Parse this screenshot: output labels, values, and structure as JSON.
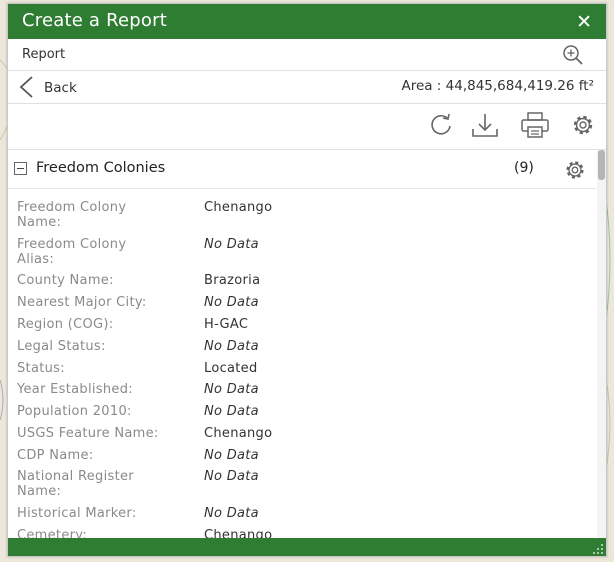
{
  "panel": {
    "title": "Create a Report",
    "close_label": "✕",
    "report_label": "Report",
    "back_label": "Back",
    "area_text": "Area : 44,845,684,419.26 ft²"
  },
  "section": {
    "title": "Freedom Colonies",
    "count": "(9)"
  },
  "fields": [
    {
      "name": "Freedom Colony\nName:",
      "value": "Chenango",
      "no_data": false
    },
    {
      "name": "Freedom Colony\nAlias:",
      "value": "No Data",
      "no_data": true
    },
    {
      "name": "County Name:",
      "value": "Brazoria",
      "no_data": false
    },
    {
      "name": "Nearest Major City:",
      "value": "No Data",
      "no_data": true
    },
    {
      "name": "Region (COG):",
      "value": "H-GAC",
      "no_data": false
    },
    {
      "name": "Legal Status:",
      "value": "No Data",
      "no_data": true
    },
    {
      "name": "Status:",
      "value": "Located",
      "no_data": false
    },
    {
      "name": "Year Established:",
      "value": "No Data",
      "no_data": true
    },
    {
      "name": "Population 2010:",
      "value": "No Data",
      "no_data": true
    },
    {
      "name": "USGS Feature Name:",
      "value": "Chenango",
      "no_data": false
    },
    {
      "name": "CDP Name:",
      "value": "No Data",
      "no_data": true
    },
    {
      "name": "National Register\nName:",
      "value": "No Data",
      "no_data": true
    },
    {
      "name": "Historical Marker:",
      "value": "No Data",
      "no_data": true
    },
    {
      "name": "Cemetery:",
      "value": "Chenango",
      "no_data": false
    }
  ],
  "icons": {
    "zoom": "zoom-in-icon",
    "back": "chevron-left-icon",
    "refresh": "refresh-icon",
    "download": "download-icon",
    "print": "print-icon",
    "settings": "gear-icon",
    "collapse": "collapse-icon",
    "resize": "resize-grip-icon"
  },
  "colors": {
    "header_green": "#2e7d32",
    "label_gray": "#8a8a8a",
    "value_text": "#333333"
  }
}
